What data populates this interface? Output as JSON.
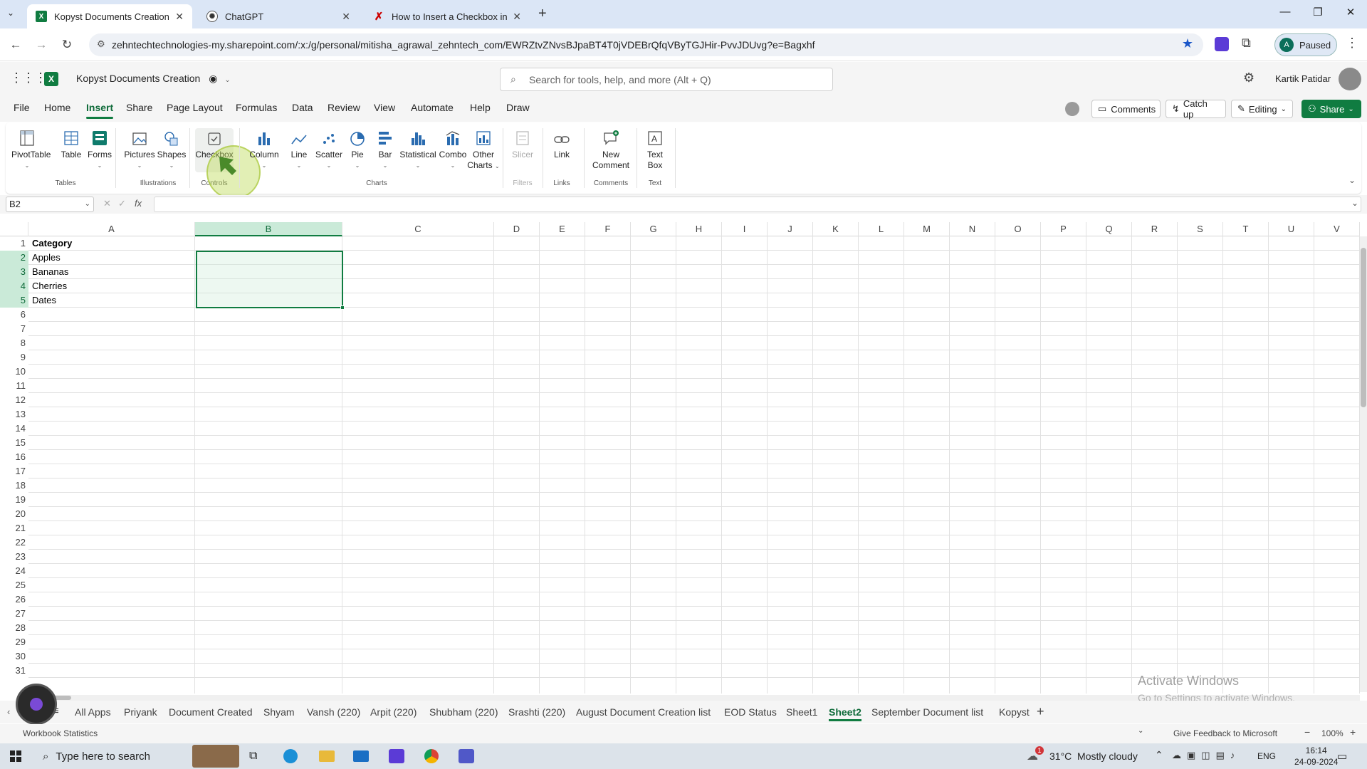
{
  "browser": {
    "tabs": [
      {
        "title": "Kopyst Documents Creation.xls",
        "active": true,
        "favicon": "excel-icon"
      },
      {
        "title": "ChatGPT",
        "active": false,
        "favicon": "chatgpt-icon"
      },
      {
        "title": "How to Insert a Checkbox in Ex",
        "active": false,
        "favicon": "x-logo-icon"
      }
    ],
    "url": "zehntechtechnologies-my.sharepoint.com/:x:/g/personal/mitisha_agrawal_zehntech_com/EWRZtvZNvsBJpaBT4T0jVDEBrQfqVByTGJHir-PvvJDUvg?e=Bagxhf",
    "profile_initial": "A",
    "profile_status": "Paused"
  },
  "excel": {
    "doc_title": "Kopyst Documents Creation",
    "search_placeholder": "Search for tools, help, and more (Alt + Q)",
    "user_name": "Kartik Patidar",
    "menu_tabs": [
      "File",
      "Home",
      "Insert",
      "Share",
      "Page Layout",
      "Formulas",
      "Data",
      "Review",
      "View",
      "Automate",
      "Help",
      "Draw"
    ],
    "active_menu": "Insert",
    "header_buttons": {
      "comments": "Comments",
      "catch_up": "Catch up",
      "editing": "Editing",
      "share": "Share"
    },
    "ribbon": {
      "pivottable": "PivotTable",
      "table": "Table",
      "forms": "Forms",
      "pictures": "Pictures",
      "shapes": "Shapes",
      "checkbox": "Checkbox",
      "column": "Column",
      "line": "Line",
      "scatter": "Scatter",
      "pie": "Pie",
      "bar": "Bar",
      "statistical": "Statistical",
      "combo": "Combo",
      "other_charts_1": "Other",
      "other_charts_2": "Charts",
      "slicer": "Slicer",
      "link": "Link",
      "new_comment_1": "New",
      "new_comment_2": "Comment",
      "text_box_1": "Text",
      "text_box_2": "Box",
      "groups": {
        "tables": "Tables",
        "illustrations": "Illustrations",
        "controls": "Controls",
        "charts": "Charts",
        "filters": "Filters",
        "links": "Links",
        "comments": "Comments",
        "text": "Text"
      }
    },
    "name_box": "B2",
    "columns": [
      "A",
      "B",
      "C",
      "D",
      "E",
      "F",
      "G",
      "H",
      "I",
      "J",
      "K",
      "L",
      "M",
      "N",
      "O",
      "P",
      "Q",
      "R",
      "S",
      "T",
      "U",
      "V"
    ],
    "rows": [
      "1",
      "2",
      "3",
      "4",
      "5",
      "6",
      "7",
      "8",
      "9",
      "10",
      "11",
      "12",
      "13",
      "14",
      "15",
      "16",
      "17",
      "18",
      "19",
      "20",
      "21",
      "22",
      "23",
      "24",
      "25",
      "26",
      "27",
      "28",
      "29",
      "30",
      "31"
    ],
    "cells": {
      "A1": "Category",
      "A2": "Apples",
      "A3": "Bananas",
      "A4": "Cherries",
      "A5": "Dates"
    },
    "sheet_tabs": [
      "All Apps",
      "Priyank",
      "Document Created",
      "Shyam",
      "Vansh (220)",
      "Arpit (220)",
      "Shubham (220)",
      "Srashti (220)",
      "August Document Creation list",
      "EOD Status",
      "Sheet1",
      "Sheet2",
      "September Document list",
      "Kopyst"
    ],
    "active_sheet": "Sheet2",
    "status_left": "Workbook Statistics",
    "feedback": "Give Feedback to Microsoft",
    "zoom": "100%",
    "watermark_1": "Activate Windows",
    "watermark_2": "Go to Settings to activate Windows."
  },
  "taskbar": {
    "search_placeholder": "Type here to search",
    "weather": "31°C  Mostly cloudy",
    "lang": "ENG",
    "time": "16:14",
    "date": "24-09-2024",
    "notif_badge": "1"
  },
  "colors": {
    "excel_green": "#107c41",
    "selection_fill": "#caead8",
    "chrome_tabstrip": "#dbe6f6"
  }
}
